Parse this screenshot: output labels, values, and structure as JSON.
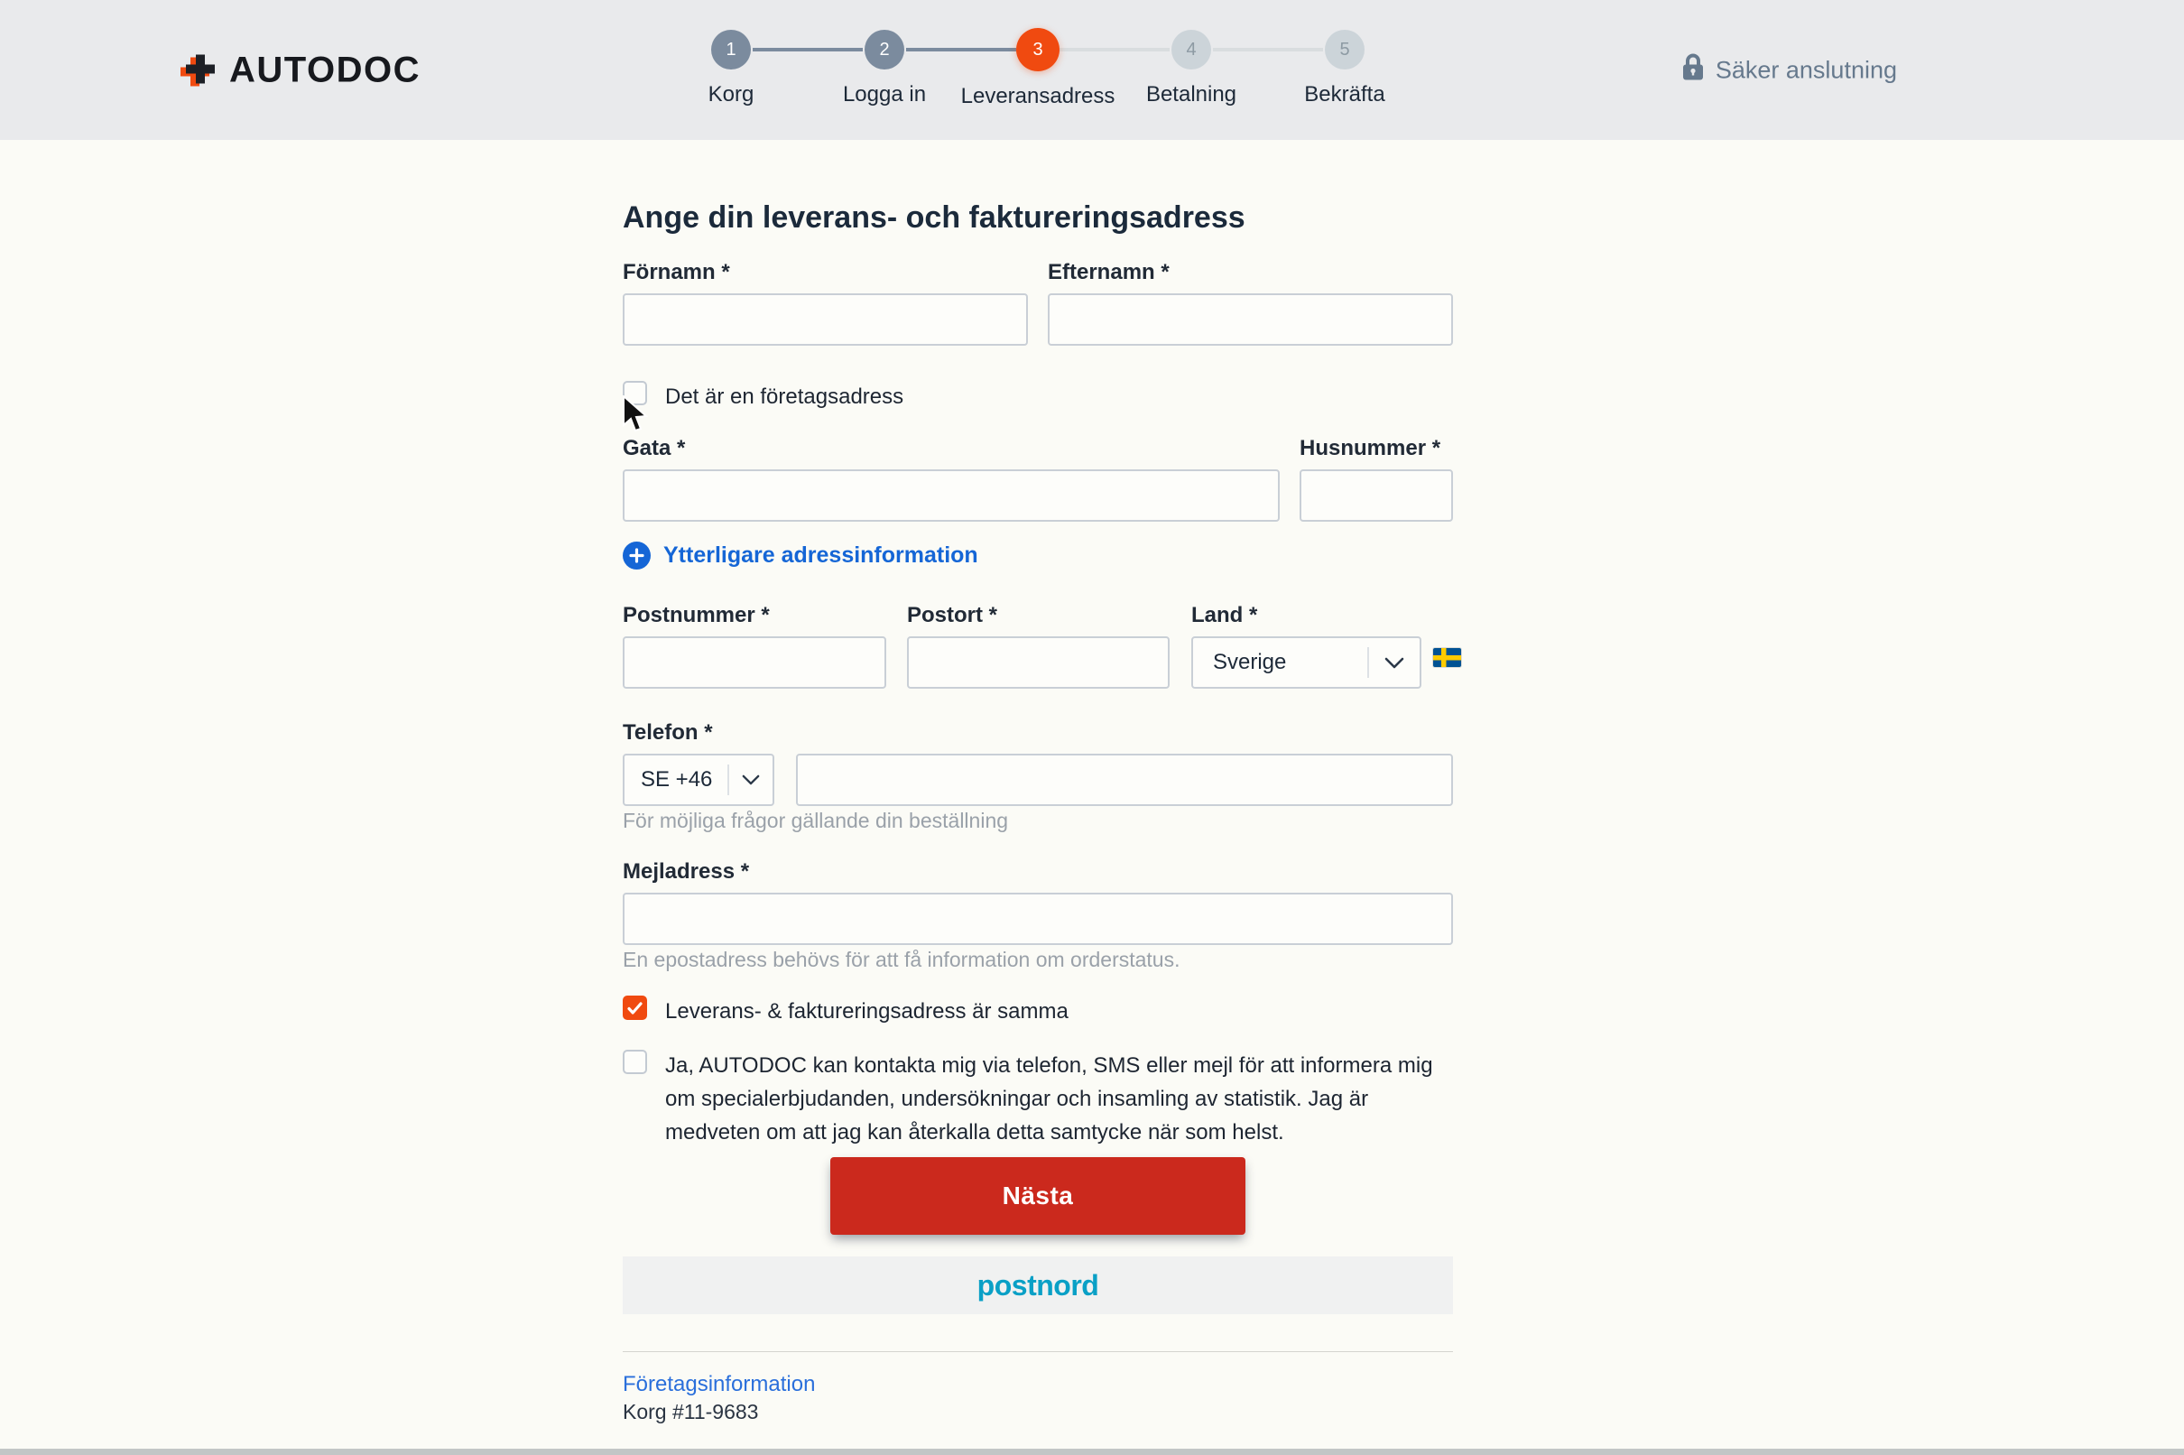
{
  "header": {
    "logo_text": "AUTODOC",
    "secure_label": "Säker anslutning",
    "steps": [
      {
        "num": "1",
        "label": "Korg",
        "state": "done"
      },
      {
        "num": "2",
        "label": "Logga in",
        "state": "done"
      },
      {
        "num": "3",
        "label": "Leveransadress",
        "state": "active"
      },
      {
        "num": "4",
        "label": "Betalning",
        "state": "upcoming"
      },
      {
        "num": "5",
        "label": "Bekräfta",
        "state": "upcoming"
      }
    ]
  },
  "form": {
    "title": "Ange din leverans- och faktureringsadress",
    "first_name": {
      "label": "Förnamn *",
      "value": ""
    },
    "last_name": {
      "label": "Efternamn *",
      "value": ""
    },
    "company_checkbox": {
      "label": "Det är en företagsadress",
      "checked": false
    },
    "street": {
      "label": "Gata *",
      "value": ""
    },
    "house_number": {
      "label": "Husnummer *",
      "value": ""
    },
    "additional_address_link": "Ytterligare adressinformation",
    "postcode": {
      "label": "Postnummer *",
      "value": ""
    },
    "city": {
      "label": "Postort *",
      "value": ""
    },
    "country": {
      "label": "Land *",
      "selected": "Sverige",
      "flag": "sweden-flag"
    },
    "phone": {
      "label": "Telefon *",
      "prefix_selected": "SE +46",
      "value": "",
      "hint": "För möjliga frågor gällande din beställning"
    },
    "email": {
      "label": "Mejladress *",
      "value": "",
      "hint": "En epostadress behövs för att få information om orderstatus."
    },
    "same_address_checkbox": {
      "label": "Leverans- & faktureringsadress är samma",
      "checked": true
    },
    "consent_checkbox": {
      "label": "Ja, AUTODOC kan kontakta mig via telefon, SMS eller mejl för att informera mig om specialerbjudanden, undersökningar och insamling av statistik. Jag är medveten om att jag kan återkalla detta samtycke när som helst.",
      "checked": false
    },
    "submit_label": "Nästa"
  },
  "carrier": {
    "name": "postnord"
  },
  "footer": {
    "company_info_link": "Företagsinformation",
    "cart_reference": "Korg #11-9683"
  },
  "colors": {
    "accent_orange": "#f04a10",
    "button_red": "#cb291d",
    "link_blue": "#1566d6",
    "postnord_teal": "#0aa0c6",
    "header_bg": "#e9eaec",
    "step_done": "#7b8b9e",
    "step_upcoming": "#ccd4d9"
  }
}
